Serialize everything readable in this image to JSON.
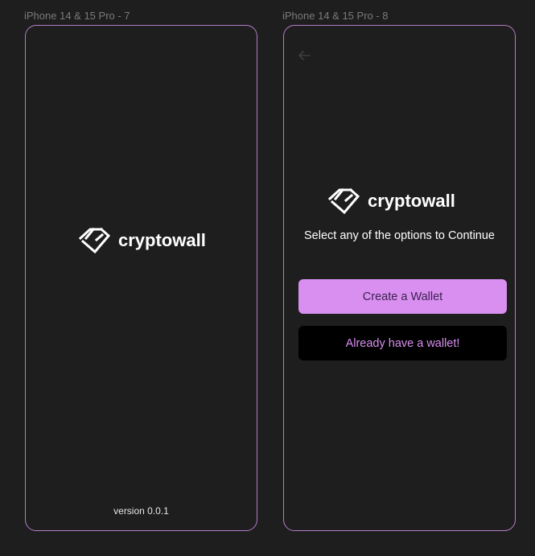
{
  "frames": [
    {
      "label": "iPhone 14 & 15 Pro - 7",
      "brand": "cryptowall",
      "version": "version 0.0.1"
    },
    {
      "label": "iPhone 14 & 15 Pro - 8",
      "brand": "cryptowall",
      "subtitle": "Select any of the options to Continue",
      "create_wallet_label": "Create a Wallet",
      "existing_wallet_label": "Already have a  wallet!"
    }
  ],
  "colors": {
    "background": "#1e1e1e",
    "frame_border": "#b57cc9",
    "accent": "#d98ff0",
    "button_dark": "#000000",
    "text_primary": "#ffffff"
  },
  "icons": {
    "logo": "cryptowall-logo-icon",
    "back": "back-arrow-icon"
  }
}
